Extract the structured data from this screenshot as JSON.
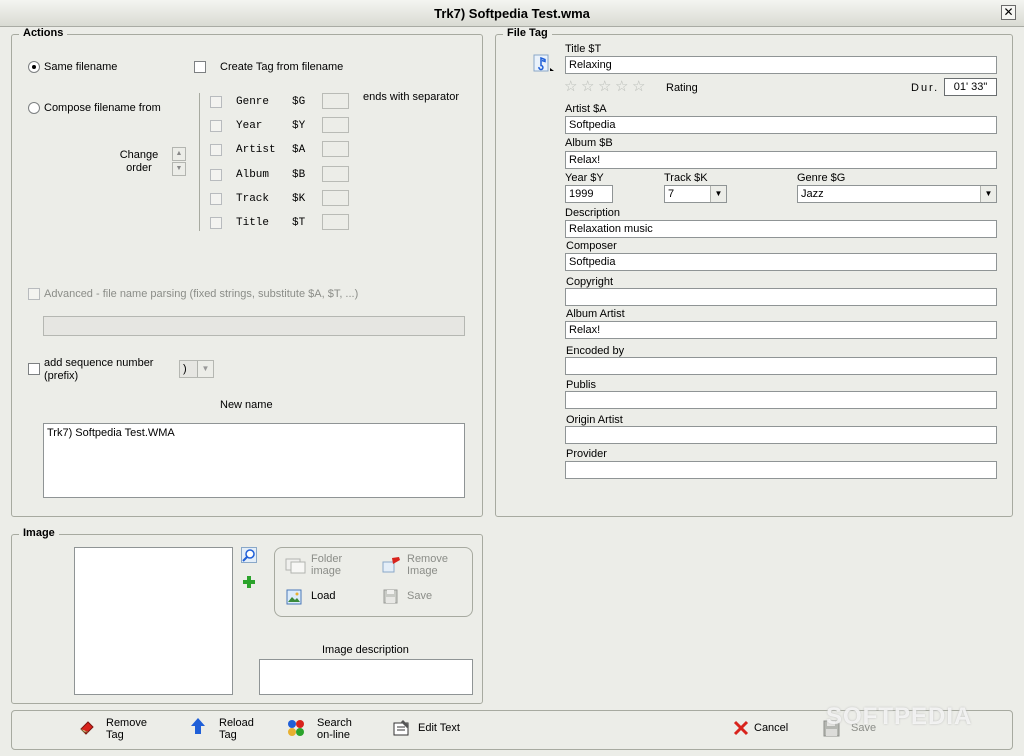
{
  "window": {
    "title": "Trk7) Softpedia Test.wma",
    "close": "✕"
  },
  "actions": {
    "group_label": "Actions",
    "same_filename": "Same filename",
    "create_tag": "Create Tag from filename",
    "compose": "Compose filename from",
    "ends_sep": "ends with separator",
    "change_order": "Change\norder",
    "fields": [
      {
        "name": "Genre",
        "code": "$G"
      },
      {
        "name": "Year",
        "code": "$Y"
      },
      {
        "name": "Artist",
        "code": "$A"
      },
      {
        "name": "Album",
        "code": "$B"
      },
      {
        "name": "Track",
        "code": "$K"
      },
      {
        "name": "Title",
        "code": "$T"
      }
    ],
    "advanced": "Advanced - file name parsing (fixed strings, substitute $A, $T, ...)",
    "add_seq": "add sequence number\n(prefix)",
    "seq_value": ")",
    "new_name_label": "New name",
    "new_name_value": "Trk7) Softpedia Test.WMA"
  },
  "filetag": {
    "group_label": "File Tag",
    "title_label": "Title   $T",
    "title_value": "Relaxing",
    "rating_label": "Rating",
    "rating_value": 0,
    "rating_max": 5,
    "dur_label": "Dur.",
    "dur_value": "01' 33\"",
    "artist_label": "Artist   $A",
    "artist_value": "Softpedia",
    "album_label": "Album   $B",
    "album_value": "Relax!",
    "year_label": "Year    $Y",
    "year_value": "1999",
    "track_label": "Track   $K",
    "track_value": "7",
    "genre_label": "Genre    $G",
    "genre_value": "Jazz",
    "description_label": "Description",
    "description_value": "Relaxation music",
    "composer_label": "Composer",
    "composer_value": "Softpedia",
    "copyright_label": "Copyright",
    "copyright_value": "",
    "album_artist_label": "Album Artist",
    "album_artist_value": "Relax!",
    "encoded_label": "Encoded by",
    "encoded_value": "",
    "publis_label": "Publis",
    "publis_value": "",
    "origin_label": "Origin Artist",
    "origin_value": "",
    "provider_label": "Provider",
    "provider_value": ""
  },
  "image": {
    "group_label": "Image",
    "folder_image": "Folder\nimage",
    "remove_image": "Remove\nImage",
    "load": "Load",
    "save": "Save",
    "desc_label": "Image description",
    "desc_value": ""
  },
  "toolbar": {
    "remove_tag": "Remove\nTag",
    "reload_tag": "Reload\nTag",
    "search_online": "Search\non-line",
    "edit_text": "Edit Text",
    "cancel": "Cancel",
    "save": "Save"
  },
  "watermark": "SOFTPEDIA",
  "colors": {
    "accent_blue": "#1f5fd8",
    "cancel_red": "#d8231c",
    "plus_green": "#2ba32b"
  }
}
